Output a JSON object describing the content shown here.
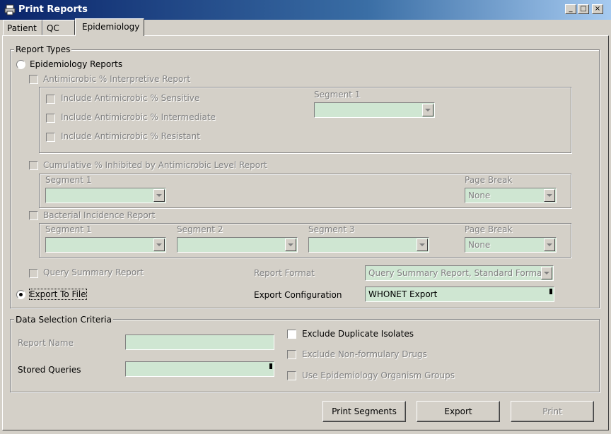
{
  "window": {
    "title": "Print Reports"
  },
  "tabs": [
    "Patient",
    "QC",
    "Epidemiology"
  ],
  "report_types": {
    "legend": "Report Types",
    "epidemiology_radio": "Epidemiology Reports",
    "antimicrobic_interpretive": "Antimicrobic % Interpretive Report",
    "include_sensitive": "Include Antimicrobic % Sensitive",
    "include_intermediate": "Include Antimicrobic % Intermediate",
    "include_resistant": "Include Antimicrobic % Resistant",
    "segment1_label": "Segment 1",
    "cumulative": "Cumulative % Inhibited by Antimicrobic Level Report",
    "cum_segment1_label": "Segment 1",
    "cum_page_break_label": "Page Break",
    "cum_page_break_value": "None",
    "bacterial": "Bacterial Incidence Report",
    "bac_segment1_label": "Segment 1",
    "bac_segment2_label": "Segment 2",
    "bac_segment3_label": "Segment 3",
    "bac_page_break_label": "Page Break",
    "bac_page_break_value": "None",
    "query_summary": "Query Summary Report",
    "report_format_label": "Report Format",
    "report_format_value": "Query Summary Report, Standard Format",
    "export_radio": "Export To File",
    "export_config_label": "Export Configuration",
    "export_config_value": "WHONET Export"
  },
  "data_selection": {
    "legend": "Data Selection Criteria",
    "report_name_label": "Report Name",
    "stored_queries_label": "Stored Queries",
    "exclude_duplicates": "Exclude Duplicate Isolates",
    "exclude_nonformulary": "Exclude Non-formulary Drugs",
    "use_organism_groups": "Use Epidemiology Organism Groups"
  },
  "buttons": {
    "print_segments": "Print Segments",
    "export": "Export",
    "print": "Print"
  },
  "colors": {
    "field_bg": "#cfe6d2",
    "title_start": "#0a246a",
    "title_end": "#a6caf0"
  }
}
